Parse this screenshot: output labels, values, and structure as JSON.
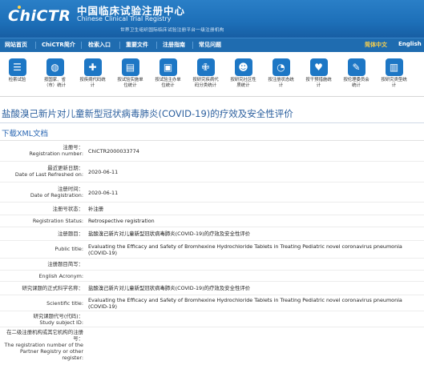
{
  "header": {
    "logo": "ChiCTR",
    "site_name_cn": "中国临床试验注册中心",
    "site_name_en": "Chinese Clinical Trial Registry",
    "subtitle": "世界卫生组织国际临床试验注册平台一级注册机构"
  },
  "nav": {
    "items": [
      "网站首页",
      "ChiCTR简介",
      "检索入口",
      "重要文件",
      "注册指南",
      "常见问题"
    ],
    "lang_cn": "简体中文",
    "lang_en": "English",
    "colors": {
      "bar": "#1f6cb0",
      "lang_active": "#ffd24a"
    }
  },
  "icons": [
    {
      "name": "search-trials-icon",
      "glyph": "☰",
      "label": "检索试验"
    },
    {
      "name": "by-country-icon",
      "glyph": "◍",
      "label": "按国家、省（市）统计"
    },
    {
      "name": "by-disease-icon",
      "glyph": "✚",
      "label": "按疾病代码统计"
    },
    {
      "name": "by-type-icon",
      "glyph": "▤",
      "label": "按试验实施单位统计"
    },
    {
      "name": "by-sponsor-icon",
      "glyph": "▣",
      "label": "按试验主办单位统计"
    },
    {
      "name": "by-drug-icon",
      "glyph": "✙",
      "label": "按研究疾病代码分类统计"
    },
    {
      "name": "by-cro-icon",
      "glyph": "☻",
      "label": "按研究社区性质统计"
    },
    {
      "name": "by-status-icon",
      "glyph": "◔",
      "label": "按注册状态统计"
    },
    {
      "name": "by-intervention-icon",
      "glyph": "♥",
      "label": "按干预措施统计"
    },
    {
      "name": "by-ethics-icon",
      "glyph": "✎",
      "label": "按伦理委员会统计"
    },
    {
      "name": "by-study-type-icon",
      "glyph": "▥",
      "label": "按研究类型统计"
    }
  ],
  "page": {
    "title": "盐酸溴己新片对儿童新型冠状病毒肺炎(COVID-19)的疗效及安全性评价",
    "xml_link": "下载XML文档"
  },
  "fields": [
    {
      "label_cn": "注册号：",
      "label_en": "Registration number:",
      "value": "ChiCTR2000033774"
    },
    {
      "label_cn": "最近更新日期：",
      "label_en": "Date of Last Refreshed on:",
      "value": "2020-06-11"
    },
    {
      "label_cn": "注册时间：",
      "label_en": "Date of Registration:",
      "value": "2020-06-11"
    },
    {
      "label_cn": "注册号状态：",
      "label_en": "",
      "value": "补注册"
    },
    {
      "label_cn": "",
      "label_en": "Registration Status:",
      "value": "Retrospective registration"
    },
    {
      "label_cn": "注册题目：",
      "label_en": "",
      "value": "盐酸溴己新片对儿童新型冠状病毒肺炎(COVID-19)的疗效及安全性评价"
    },
    {
      "label_cn": "",
      "label_en": "Public title:",
      "value": "Evaluating the Efficacy and Safety of Bromhexine Hydrochloride Tablets in Treating Pediatric novel coronavirus pneumonia (COVID-19)"
    },
    {
      "label_cn": "注册题目简写：",
      "label_en": "",
      "value": ""
    },
    {
      "label_cn": "",
      "label_en": "English Acronym:",
      "value": ""
    },
    {
      "label_cn": "研究课题的正式科学名称：",
      "label_en": "",
      "value": "盐酸溴己新片对儿童新型冠状病毒肺炎(COVID-19)的疗效及安全性评价"
    },
    {
      "label_cn": "",
      "label_en": "Scientific title:",
      "value": "Evaluating the Efficacy and Safety of Bromhexine Hydrochloride Tablets in Treating Pediatric novel coronavirus pneumonia (COVID-19)"
    },
    {
      "label_cn": "研究课题代号(代码)：",
      "label_en": "Study subject ID:",
      "value": ""
    },
    {
      "label_cn": "在二级注册机构或其它机构的注册号：",
      "label_en": "The registration number of the Partner Registry or other register:",
      "value": ""
    }
  ]
}
